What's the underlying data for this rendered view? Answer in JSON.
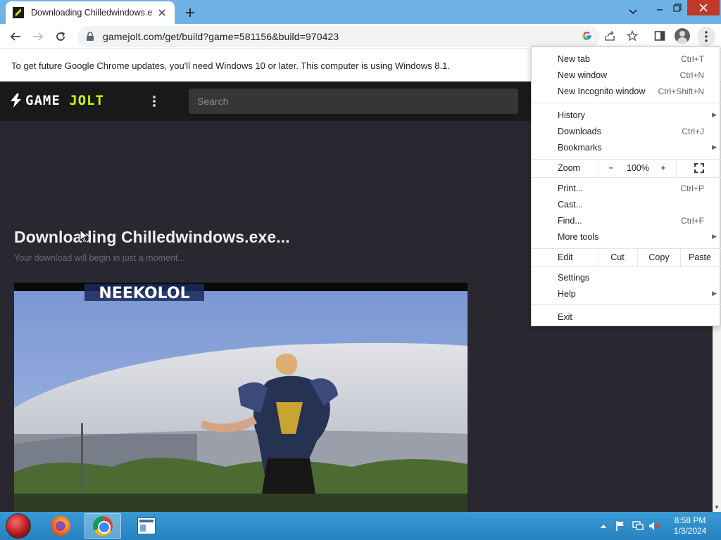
{
  "browser": {
    "tab": {
      "title": "Downloading Chilledwindows.exe..."
    },
    "url": "gamejolt.com/get/build?game=581156&build=970423"
  },
  "infobar": {
    "message": "To get future Google Chrome updates, you'll need Windows 10 or later. This computer is using Windows 8.1."
  },
  "site": {
    "logo": {
      "part1": "GAME",
      "part2": "JOLT",
      "accent_color": "#ccff00"
    },
    "search": {
      "placeholder": "Search"
    },
    "download": {
      "title": "Downloading Chilledwindows.exe...",
      "subtitle": "Your download will begin in just a moment..."
    },
    "media": {
      "overlay_text": "NEEKOLOL"
    }
  },
  "chrome_menu": {
    "new_tab": {
      "label": "New tab",
      "shortcut": "Ctrl+T"
    },
    "new_window": {
      "label": "New window",
      "shortcut": "Ctrl+N"
    },
    "new_incognito": {
      "label": "New Incognito window",
      "shortcut": "Ctrl+Shift+N"
    },
    "history": {
      "label": "History"
    },
    "downloads": {
      "label": "Downloads",
      "shortcut": "Ctrl+J"
    },
    "bookmarks": {
      "label": "Bookmarks"
    },
    "zoom": {
      "label": "Zoom",
      "minus": "−",
      "value": "100%",
      "plus": "+"
    },
    "print": {
      "label": "Print...",
      "shortcut": "Ctrl+P"
    },
    "cast": {
      "label": "Cast..."
    },
    "find": {
      "label": "Find...",
      "shortcut": "Ctrl+F"
    },
    "more_tools": {
      "label": "More tools"
    },
    "edit": {
      "label": "Edit",
      "cut": "Cut",
      "copy": "Copy",
      "paste": "Paste"
    },
    "settings": {
      "label": "Settings"
    },
    "help": {
      "label": "Help"
    },
    "exit": {
      "label": "Exit"
    }
  },
  "taskbar": {
    "apps": [
      "firefox",
      "chrome",
      "window-app"
    ],
    "clock": {
      "time": "8:58 PM",
      "date": "1/3/2024"
    }
  }
}
